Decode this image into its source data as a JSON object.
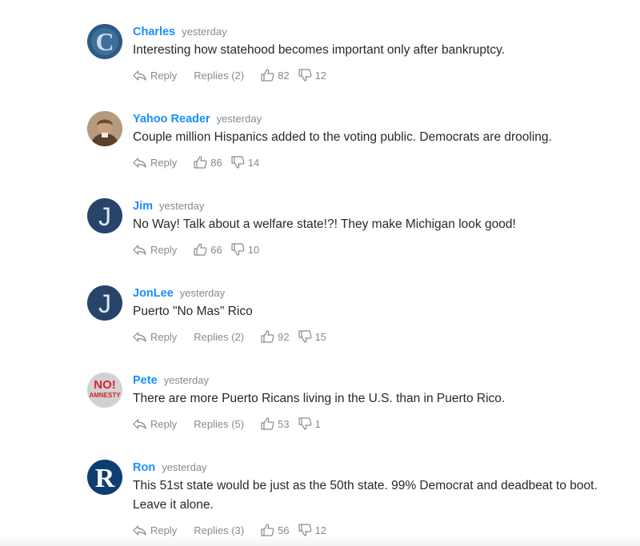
{
  "comments": [
    {
      "author": "Charles",
      "time": "yesterday",
      "text": "Interesting how statehood becomes important only after bankruptcy.",
      "reply_label": "Reply",
      "replies_label": "Replies (2)",
      "likes": "82",
      "dislikes": "12",
      "avatar_letter": "C",
      "avatar_color": "#2f5f86"
    },
    {
      "author": "Yahoo Reader",
      "time": "yesterday",
      "text": "Couple million Hispanics added to the voting public. Democrats are drooling.",
      "reply_label": "Reply",
      "likes": "86",
      "dislikes": "14",
      "avatar_color": "#9a7b5e"
    },
    {
      "author": "Jim",
      "time": "yesterday",
      "text": "No Way! Talk about a welfare state!?! They make Michigan look good!",
      "reply_label": "Reply",
      "likes": "66",
      "dislikes": "10",
      "avatar_letter": "J",
      "avatar_color": "#27446b"
    },
    {
      "author": "JonLee",
      "time": "yesterday",
      "text": "Puerto \"No Mas\" Rico",
      "reply_label": "Reply",
      "replies_label": "Replies (2)",
      "likes": "92",
      "dislikes": "15",
      "avatar_letter": "J",
      "avatar_color": "#27446b"
    },
    {
      "author": "Pete",
      "time": "yesterday",
      "text": "There are more Puerto Ricans living in the U.S. than in Puerto Rico.",
      "reply_label": "Reply",
      "replies_label": "Replies (5)",
      "likes": "53",
      "dislikes": "1",
      "avatar_line1": "NO!",
      "avatar_line2": "AMNESTY",
      "avatar_color": "#cfcfcf"
    },
    {
      "author": "Ron",
      "time": "yesterday",
      "text": "This 51st state would be just as the 50th state. 99% Democrat and deadbeat to boot. Leave it alone.",
      "reply_label": "Reply",
      "replies_label": "Replies (3)",
      "likes": "56",
      "dislikes": "12",
      "avatar_letter": "R",
      "avatar_color": "#0d3d73"
    }
  ]
}
